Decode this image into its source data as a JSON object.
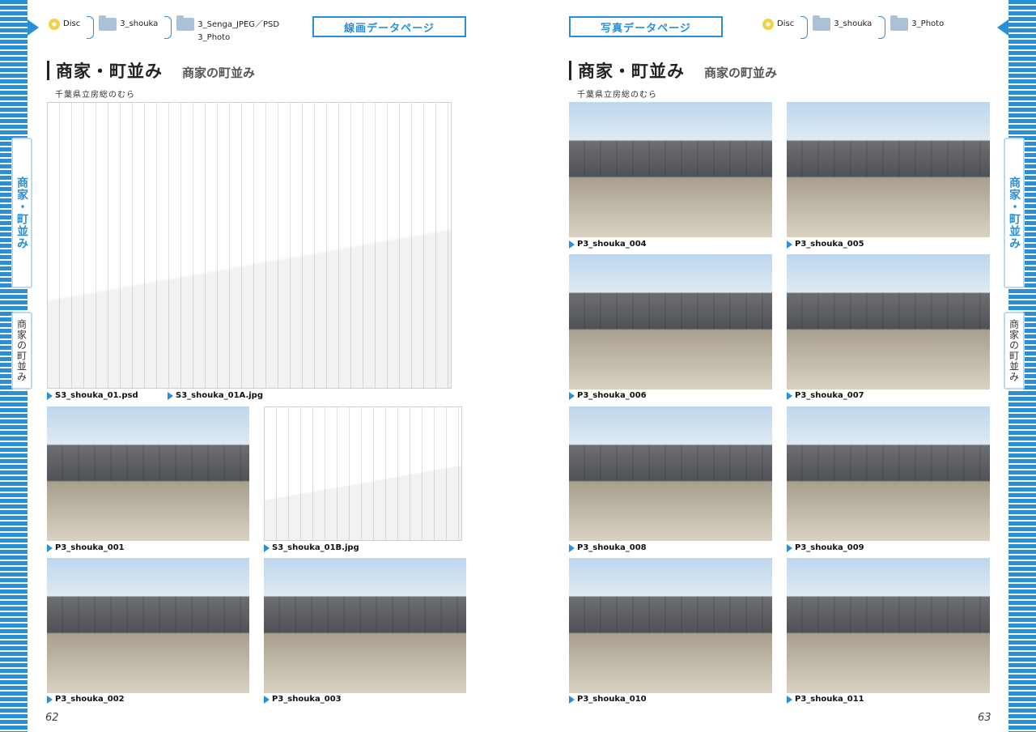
{
  "left_page": {
    "breadcrumb": [
      {
        "icon": "disc-icon",
        "lines": [
          "Disc"
        ]
      },
      {
        "icon": "folder-icon",
        "lines": [
          "3_shouka"
        ]
      },
      {
        "icon": "folder-icon",
        "lines": [
          "3_Senga_JPEG／PSD",
          "3_Photo"
        ]
      }
    ],
    "badge": "線画データページ",
    "title": "商家・町並み",
    "subtitle": "商家の町並み",
    "location": "千葉県立房総のむら",
    "side_tab_category": "商家・町並み",
    "side_tab_sub": "商家の町並み",
    "items": [
      {
        "kind": "line",
        "caption": "S3_shouka_01.psd",
        "caption2": "S3_shouka_01A.jpg"
      },
      {
        "kind": "photo",
        "caption": "P3_shouka_001"
      },
      {
        "kind": "line",
        "caption": "S3_shouka_01B.jpg"
      },
      {
        "kind": "photo",
        "caption": "P3_shouka_002"
      },
      {
        "kind": "photo",
        "caption": "P3_shouka_003"
      }
    ],
    "page_number": "62"
  },
  "right_page": {
    "breadcrumb": [
      {
        "icon": "disc-icon",
        "lines": [
          "Disc"
        ]
      },
      {
        "icon": "folder-icon",
        "lines": [
          "3_shouka"
        ]
      },
      {
        "icon": "folder-icon",
        "lines": [
          "3_Photo"
        ]
      }
    ],
    "badge": "写真データページ",
    "title": "商家・町並み",
    "subtitle": "商家の町並み",
    "location": "千葉県立房総のむら",
    "side_tab_category": "商家・町並み",
    "side_tab_sub": "商家の町並み",
    "items": [
      {
        "kind": "photo",
        "caption": "P3_shouka_004"
      },
      {
        "kind": "photo",
        "caption": "P3_shouka_005"
      },
      {
        "kind": "photo",
        "caption": "P3_shouka_006"
      },
      {
        "kind": "photo",
        "caption": "P3_shouka_007"
      },
      {
        "kind": "photo",
        "caption": "P3_shouka_008"
      },
      {
        "kind": "photo",
        "caption": "P3_shouka_009"
      },
      {
        "kind": "photo",
        "caption": "P3_shouka_010"
      },
      {
        "kind": "photo",
        "caption": "P3_shouka_011"
      }
    ],
    "page_number": "63"
  },
  "colors": {
    "accent": "#2b8fd6",
    "text": "#222222"
  }
}
